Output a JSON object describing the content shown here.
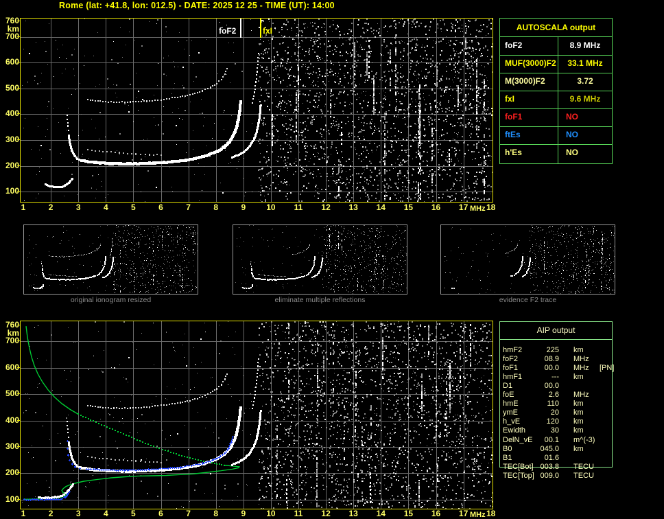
{
  "title": "Rome (lat: +41.8, lon: 012.5) - DATE: 2025 12 25 - TIME (UT): 14:00",
  "station": {
    "name": "Rome",
    "lat": "+41.8",
    "lon": "012.5",
    "date": "2025 12 25",
    "time_ut": "14:00"
  },
  "autoscala_table": {
    "header": "AUTOSCALA output",
    "rows": [
      {
        "label": "foF2",
        "value": "8.9 MHz",
        "label_color": "#ffffff",
        "value_color": "#ffffff",
        "value_align": "center"
      },
      {
        "label": "MUF(3000)F2",
        "value": "33.1 MHz",
        "label_color": "#ffff00",
        "value_color": "#ffff00",
        "value_align": "center"
      },
      {
        "label": "M(3000)F2",
        "value": "3.72",
        "label_color": "#ffffa0",
        "value_color": "#ffffa0",
        "value_align": "center"
      },
      {
        "label": "fxI",
        "value": "9.6 MHz",
        "label_color": "#ffff00",
        "value_color": "#c9c900",
        "value_align": "center"
      },
      {
        "label": "foF1",
        "value": "NO",
        "label_color": "#ff2020",
        "value_color": "#ff2020",
        "value_align": "left"
      },
      {
        "label": "ftEs",
        "value": "NO",
        "label_color": "#2090ff",
        "value_color": "#2090ff",
        "value_align": "left"
      },
      {
        "label": "h'Es",
        "value": "NO",
        "label_color": "#ffff80",
        "value_color": "#ffff80",
        "value_align": "left"
      }
    ]
  },
  "aip_table": {
    "header": "AIP output",
    "rows": [
      {
        "label": "hmF2",
        "value": "225",
        "unit": "km",
        "note": ""
      },
      {
        "label": "foF2",
        "value": "08.9",
        "unit": "MHz",
        "note": ""
      },
      {
        "label": "foF1",
        "value": "00.0",
        "unit": "MHz",
        "note": "[PN]"
      },
      {
        "label": "hmF1",
        "value": "---",
        "unit": "km",
        "note": ""
      },
      {
        "label": "D1",
        "value": "00.0",
        "unit": "",
        "note": ""
      },
      {
        "label": "foE",
        "value": "2.6",
        "unit": "MHz",
        "note": ""
      },
      {
        "label": "hmE",
        "value": "110",
        "unit": "km",
        "note": ""
      },
      {
        "label": "ymE",
        "value": "20",
        "unit": "km",
        "note": ""
      },
      {
        "label": "h_vE",
        "value": "120",
        "unit": "km",
        "note": ""
      },
      {
        "label": "Ewidth",
        "value": "30",
        "unit": "km",
        "note": ""
      },
      {
        "label": "DelN_vE",
        "value": "00.1",
        "unit": "m^(-3)",
        "note": ""
      },
      {
        "label": "B0",
        "value": "045.0",
        "unit": "km",
        "note": ""
      },
      {
        "label": "B1",
        "value": "01.6",
        "unit": "",
        "note": ""
      },
      {
        "label": "TEC[Bot]",
        "value": "003.8",
        "unit": "TECU",
        "note": ""
      },
      {
        "label": "TEC[Top]",
        "value": "009.0",
        "unit": "TECU",
        "note": ""
      }
    ]
  },
  "markers": {
    "fof2": {
      "label": "foF2",
      "freq_mhz": 8.9,
      "color": "#ffffff"
    },
    "fxi": {
      "label": "fxI",
      "freq_mhz": 9.6,
      "color": "#ffff00"
    }
  },
  "axes": {
    "y_ticks": [
      "760",
      "km",
      "700",
      "600",
      "500",
      "400",
      "300",
      "200",
      "100"
    ],
    "x_ticks": [
      "1",
      "2",
      "3",
      "4",
      "5",
      "6",
      "7",
      "8",
      "9",
      "10",
      "11",
      "12",
      "13",
      "14",
      "15",
      "16",
      "17",
      "18"
    ],
    "x_unit": "MHz"
  },
  "thumbnails": [
    {
      "caption": "original ionogram resized",
      "traces": [
        {
          "name": "e_top"
        },
        {
          "name": "retard_tail"
        },
        {
          "name": "retard_lower"
        },
        {
          "name": "f_main"
        },
        {
          "name": "x_branch"
        },
        {
          "name": "upper_faint"
        },
        {
          "name": "hop2"
        },
        {
          "name": "hop2_steep"
        }
      ],
      "noise_seed": 771
    },
    {
      "caption": "eliminate multiple reflections",
      "traces": [
        {
          "name": "e_top"
        },
        {
          "name": "retard_tail"
        },
        {
          "name": "retard_lower"
        },
        {
          "name": "f_main"
        },
        {
          "name": "x_branch"
        },
        {
          "name": "upper_faint"
        },
        {
          "name": "hop2",
          "fmin": 6.3
        }
      ],
      "noise_seed": 992
    },
    {
      "caption": "evidence F2 trace",
      "traces": [
        {
          "name": "f_main",
          "fmin": 7.5
        },
        {
          "name": "x_branch",
          "fmin": 8.7
        },
        {
          "name": "hop2",
          "fmin": 6.9
        },
        {
          "name": "e_top",
          "fmin": 1.9,
          "fmax": 2.3
        }
      ],
      "noise_seed": 1233
    }
  ],
  "chart_data": {
    "type": "scatter",
    "title": "Vertical incidence ionogram, echo virtual height vs sounding frequency",
    "xlabel": "MHz",
    "ylabel": "km",
    "x_range": [
      1,
      18
    ],
    "y_range": [
      100,
      760
    ],
    "grid": {
      "x_step_mhz": 1,
      "y_step_km": 100
    },
    "traces": {
      "e_top": {
        "color": "#ffffff",
        "th": 3,
        "step": 2,
        "jitter": 1,
        "points": [
          [
            1.8,
            128
          ],
          [
            1.95,
            121
          ],
          [
            2.15,
            118
          ],
          [
            2.35,
            118
          ],
          [
            2.5,
            122
          ],
          [
            2.62,
            130
          ],
          [
            2.72,
            142
          ],
          [
            2.78,
            152
          ]
        ]
      },
      "e_bot": {
        "color": "#ffffff",
        "th": 3,
        "step": 2,
        "jitter": 1,
        "points": [
          [
            1.55,
            109
          ],
          [
            1.8,
            107
          ],
          [
            2.05,
            108
          ],
          [
            2.3,
            112
          ],
          [
            2.45,
            118
          ],
          [
            2.58,
            128
          ],
          [
            2.7,
            143
          ],
          [
            2.8,
            158
          ]
        ]
      },
      "retard_tail": {
        "color": "#ffffff",
        "th": 2,
        "step": 6,
        "jitter": 1,
        "points": [
          [
            2.6,
            395
          ],
          [
            2.62,
            355
          ],
          [
            2.65,
            318
          ]
        ]
      },
      "retard_lower": {
        "color": "#ffffff",
        "th": 3,
        "step": 2,
        "jitter": 1,
        "points": [
          [
            2.65,
            318
          ],
          [
            2.7,
            285
          ],
          [
            2.76,
            260
          ],
          [
            2.85,
            240
          ],
          [
            2.97,
            228
          ],
          [
            3.12,
            220
          ]
        ]
      },
      "f_main": {
        "color": "#ffffff",
        "th": 4,
        "step": 2,
        "jitter": 1,
        "points": [
          [
            3.12,
            220
          ],
          [
            3.6,
            213
          ],
          [
            4.2,
            209
          ],
          [
            5.0,
            208
          ],
          [
            5.8,
            211
          ],
          [
            6.4,
            216
          ],
          [
            6.9,
            222
          ],
          [
            7.35,
            231
          ],
          [
            7.75,
            243
          ],
          [
            8.05,
            256
          ],
          [
            8.3,
            272
          ],
          [
            8.5,
            293
          ],
          [
            8.64,
            318
          ],
          [
            8.75,
            348
          ],
          [
            8.82,
            382
          ],
          [
            8.87,
            416
          ],
          [
            8.9,
            448
          ]
        ]
      },
      "x_branch": {
        "color": "#ffffff",
        "th": 3,
        "step": 2,
        "jitter": 1,
        "points": [
          [
            8.6,
            232
          ],
          [
            8.85,
            243
          ],
          [
            9.05,
            257
          ],
          [
            9.25,
            277
          ],
          [
            9.38,
            301
          ],
          [
            9.48,
            330
          ],
          [
            9.55,
            364
          ],
          [
            9.6,
            400
          ],
          [
            9.63,
            436
          ]
        ]
      },
      "upper_faint": {
        "color": "#b8b8b8",
        "th": 2,
        "step": 6,
        "jitter": 1,
        "points": [
          [
            3.35,
            263
          ],
          [
            3.9,
            256
          ],
          [
            4.5,
            250
          ],
          [
            5.1,
            246
          ],
          [
            5.6,
            243
          ],
          [
            6.0,
            242
          ]
        ]
      },
      "hop2": {
        "color": "#e0e0e0",
        "th": 2,
        "step": 4,
        "jitter": 1,
        "points": [
          [
            3.35,
            456
          ],
          [
            3.8,
            450
          ],
          [
            4.3,
            447
          ],
          [
            4.9,
            447
          ],
          [
            5.5,
            451
          ],
          [
            6.1,
            458
          ],
          [
            6.7,
            468
          ],
          [
            7.15,
            478
          ],
          [
            7.5,
            490
          ],
          [
            7.8,
            504
          ],
          [
            8.02,
            519
          ],
          [
            8.2,
            536
          ],
          [
            8.32,
            556
          ],
          [
            8.4,
            576
          ]
        ]
      },
      "hop2_steep": {
        "color": "#ffffff",
        "th": 2,
        "step": 5,
        "jitter": 1,
        "points": [
          [
            9.32,
            445
          ],
          [
            9.4,
            485
          ],
          [
            9.46,
            525
          ],
          [
            9.5,
            565
          ],
          [
            9.53,
            605
          ],
          [
            9.55,
            635
          ]
        ]
      }
    },
    "blue_fit": {
      "color": "#2244ff",
      "segments": [
        {
          "step": 3,
          "points": [
            [
              1.02,
              101
            ],
            [
              2.35,
              103
            ]
          ]
        },
        {
          "step": 3,
          "points": [
            [
              2.4,
              105
            ],
            [
              2.52,
              112
            ],
            [
              2.6,
              122
            ],
            [
              2.66,
              133
            ]
          ]
        },
        {
          "step": 7,
          "points": [
            [
              2.6,
              322
            ],
            [
              2.6,
              295
            ],
            [
              2.63,
              270
            ],
            [
              2.68,
              250
            ],
            [
              2.76,
              236
            ],
            [
              2.88,
              226
            ],
            [
              3.05,
              220
            ],
            [
              3.3,
              217
            ]
          ]
        },
        {
          "step": 3,
          "points": [
            [
              3.3,
              217
            ],
            [
              4.0,
              214
            ],
            [
              4.8,
              213
            ],
            [
              5.6,
              215
            ],
            [
              6.2,
              219
            ],
            [
              6.7,
              224
            ],
            [
              7.1,
              230
            ],
            [
              7.5,
              238
            ],
            [
              7.85,
              249
            ],
            [
              8.1,
              261
            ],
            [
              8.3,
              277
            ],
            [
              8.45,
              296
            ],
            [
              8.55,
              318
            ],
            [
              8.6,
              337
            ]
          ]
        }
      ]
    },
    "green_profile": {
      "color": "#00cc33",
      "topside_solid": [
        [
          1.1,
          757
        ],
        [
          1.15,
          715
        ],
        [
          1.22,
          675
        ],
        [
          1.3,
          640
        ],
        [
          1.4,
          608
        ],
        [
          1.53,
          576
        ],
        [
          1.7,
          545
        ],
        [
          1.9,
          516
        ],
        [
          2.13,
          489
        ],
        [
          2.4,
          464
        ],
        [
          2.7,
          442
        ],
        [
          3.0,
          424
        ]
      ],
      "topside_dotted": [
        [
          3.0,
          424
        ],
        [
          3.45,
          402
        ],
        [
          3.95,
          380
        ],
        [
          4.45,
          358
        ],
        [
          4.95,
          336
        ],
        [
          5.45,
          314
        ],
        [
          5.95,
          294
        ],
        [
          6.45,
          276
        ],
        [
          6.95,
          260
        ],
        [
          7.45,
          247
        ],
        [
          7.95,
          237
        ],
        [
          8.3,
          231
        ]
      ],
      "bottomside_solid": [
        [
          8.3,
          231
        ],
        [
          8.65,
          227
        ],
        [
          8.85,
          225
        ],
        [
          8.83,
          221
        ],
        [
          8.6,
          216
        ],
        [
          8.2,
          210
        ],
        [
          7.7,
          204
        ],
        [
          7.2,
          198
        ],
        [
          6.7,
          195
        ],
        [
          6.2,
          192
        ],
        [
          5.7,
          191
        ],
        [
          5.2,
          190
        ],
        [
          4.7,
          187
        ],
        [
          4.2,
          183
        ],
        [
          3.7,
          177
        ],
        [
          3.2,
          170
        ],
        [
          2.9,
          163
        ],
        [
          2.7,
          157
        ],
        [
          2.55,
          150
        ],
        [
          2.45,
          142
        ],
        [
          2.4,
          135
        ],
        [
          2.44,
          128
        ],
        [
          2.52,
          124
        ],
        [
          2.56,
          119
        ],
        [
          2.5,
          114
        ],
        [
          2.4,
          110
        ],
        [
          2.25,
          107
        ],
        [
          2.0,
          105
        ],
        [
          1.6,
          103
        ],
        [
          1.2,
          102
        ],
        [
          1.0,
          102
        ]
      ]
    },
    "plots": {
      "top": {
        "traces": [
          "e_top",
          "retard_tail",
          "retard_lower",
          "f_main",
          "x_branch",
          "upper_faint",
          "hop2",
          "hop2_steep"
        ],
        "noise_seed": 20251225,
        "blue": false,
        "green": false,
        "bright_streaks": [
          {
            "f": 13.55,
            "km1": 690,
            "km2": 545,
            "n": 8,
            "color": "#ffffff"
          },
          {
            "f": 16.45,
            "km1": 265,
            "km2": 205,
            "n": 6,
            "color": "#ffffff"
          },
          {
            "f": 16.0,
            "km1": 600,
            "km2": 510,
            "n": 10,
            "color": "#a8a8a8"
          },
          {
            "f": 12.55,
            "km1": 335,
            "km2": 290,
            "n": 4,
            "color": "#ffffff"
          }
        ]
      },
      "bottom": {
        "traces": [
          "e_bot",
          "retard_tail",
          "retard_lower",
          "f_main",
          "x_branch",
          "upper_faint",
          "hop2",
          "hop2_steep"
        ],
        "noise_seed": 14007,
        "blue": true,
        "green": true,
        "bright_streaks": [
          {
            "f": 13.6,
            "km1": 200,
            "km2": 95,
            "n": 8,
            "color": "#ffffff"
          },
          {
            "f": 10.55,
            "km1": 175,
            "km2": 95,
            "n": 6,
            "color": "#ffffff"
          },
          {
            "f": 16.3,
            "km1": 430,
            "km2": 370,
            "n": 4,
            "color": "#ffffff"
          },
          {
            "f": 11.9,
            "km1": 645,
            "km2": 595,
            "n": 8,
            "color": "#a0a0a0"
          }
        ]
      }
    }
  }
}
